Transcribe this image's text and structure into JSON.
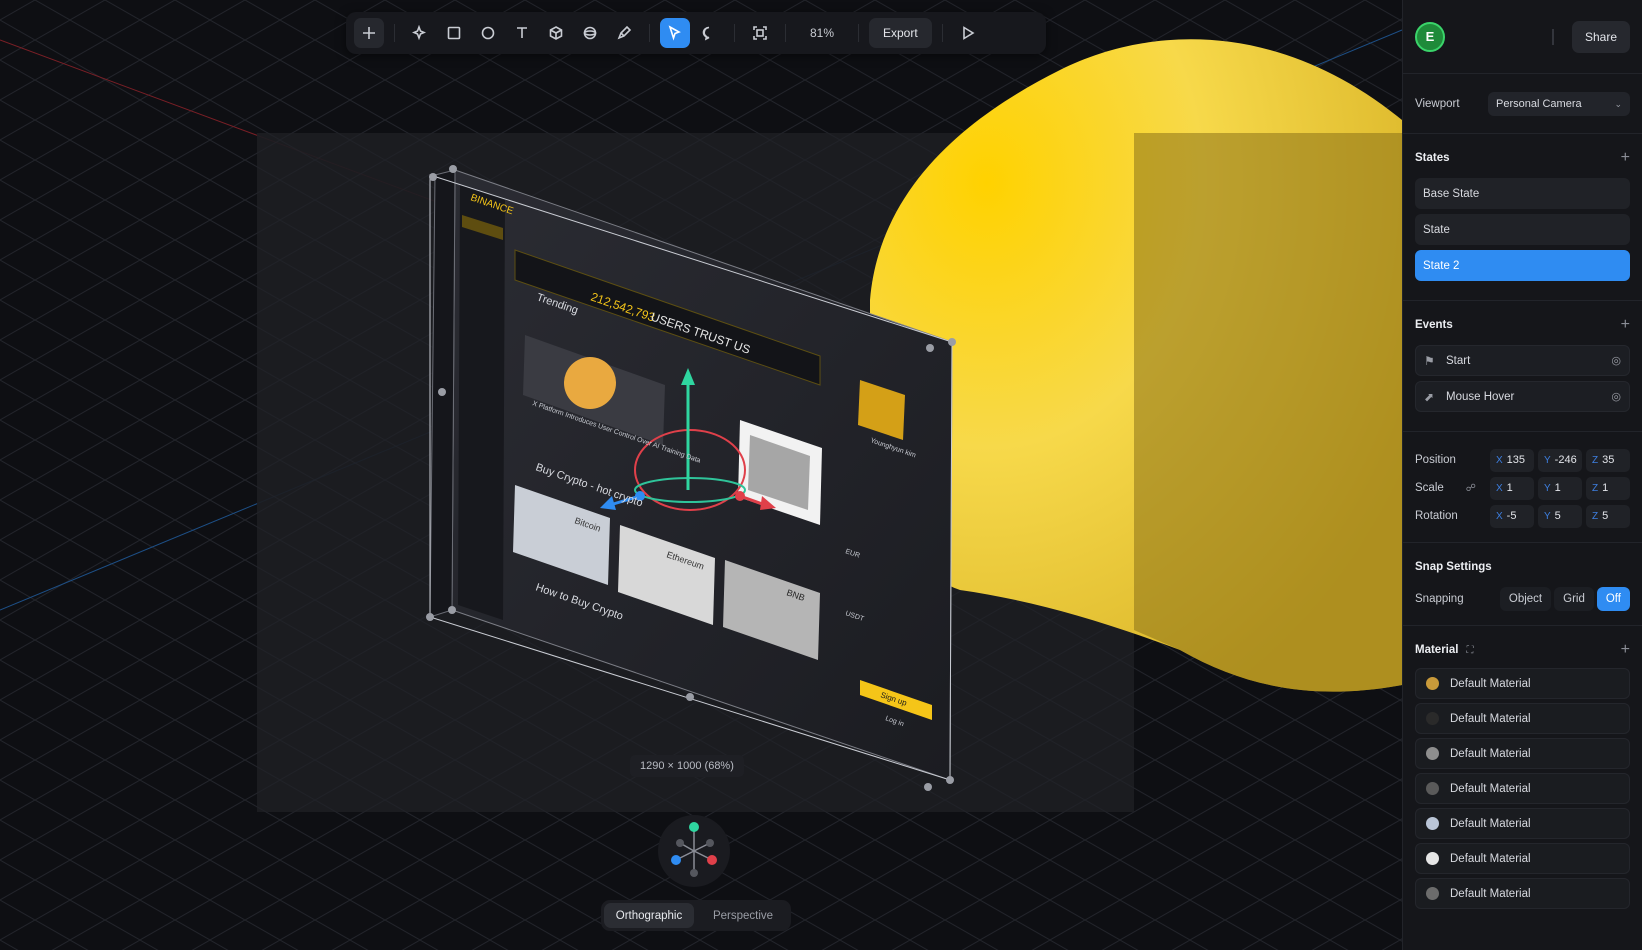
{
  "toolbar": {
    "zoom": "81%",
    "export_label": "Export",
    "tools": [
      "add-icon",
      "sparkle-icon",
      "rectangle-icon",
      "ellipse-icon",
      "text-icon",
      "cube-icon",
      "sphere-icon",
      "pen-icon",
      "pointer-icon",
      "comment-icon",
      "frame-icon",
      "play-icon"
    ]
  },
  "canvas": {
    "dimension_label": "1290 × 1000 (68%)",
    "mockup": {
      "brand": "BINANCE",
      "banner_number": "212,542,793",
      "banner_text": "USERS TRUST US",
      "trending": "Trending",
      "news": "X Platform Introduces User Control Over AI Training Data",
      "buy_crypto": "Buy Crypto - hot crypto",
      "how_to_buy": "How to Buy Crypto",
      "coins": [
        "Bitcoin",
        "Ethereum",
        "BNB"
      ],
      "profile_name": "Younghyun kim",
      "signup": "Sign up",
      "login": "Log in",
      "currency_1": "EUR",
      "currency_2": "USDT"
    },
    "accent_yellow": "#f5c518",
    "selection_blue": "#2f8cf2"
  },
  "view_toggle": {
    "orthographic": "Orthographic",
    "perspective": "Perspective",
    "active": "Orthographic"
  },
  "panel": {
    "avatar_initial": "E",
    "share_label": "Share",
    "viewport_label": "Viewport",
    "viewport_value": "Personal Camera",
    "states_title": "States",
    "states": [
      "Base State",
      "State",
      "State 2"
    ],
    "selected_state": "State 2",
    "events_title": "Events",
    "events": [
      {
        "label": "Start",
        "icon": "flag-icon"
      },
      {
        "label": "Mouse Hover",
        "icon": "cursor-hover-icon"
      }
    ],
    "position_label": "Position",
    "position": {
      "x": "135",
      "y": "-246",
      "z": "35"
    },
    "scale_label": "Scale",
    "scale": {
      "x": "1",
      "y": "1",
      "z": "1"
    },
    "rotation_label": "Rotation",
    "rotation": {
      "x": "-5",
      "y": "5",
      "z": "5"
    },
    "snap_title": "Snap Settings",
    "snapping_label": "Snapping",
    "snap_options": [
      "Object",
      "Grid",
      "Off"
    ],
    "snap_active": "Off",
    "material_title": "Material",
    "materials": [
      {
        "label": "Default Material",
        "color": "#c99a3a"
      },
      {
        "label": "Default Material",
        "color": "#2a2a2a"
      },
      {
        "label": "Default Material",
        "color": "#8e8e8e"
      },
      {
        "label": "Default Material",
        "color": "#5a5a5a"
      },
      {
        "label": "Default Material",
        "color": "#b9c4d6"
      },
      {
        "label": "Default Material",
        "color": "#e6e6e6"
      },
      {
        "label": "Default Material",
        "color": "#6c6c6c"
      }
    ]
  }
}
